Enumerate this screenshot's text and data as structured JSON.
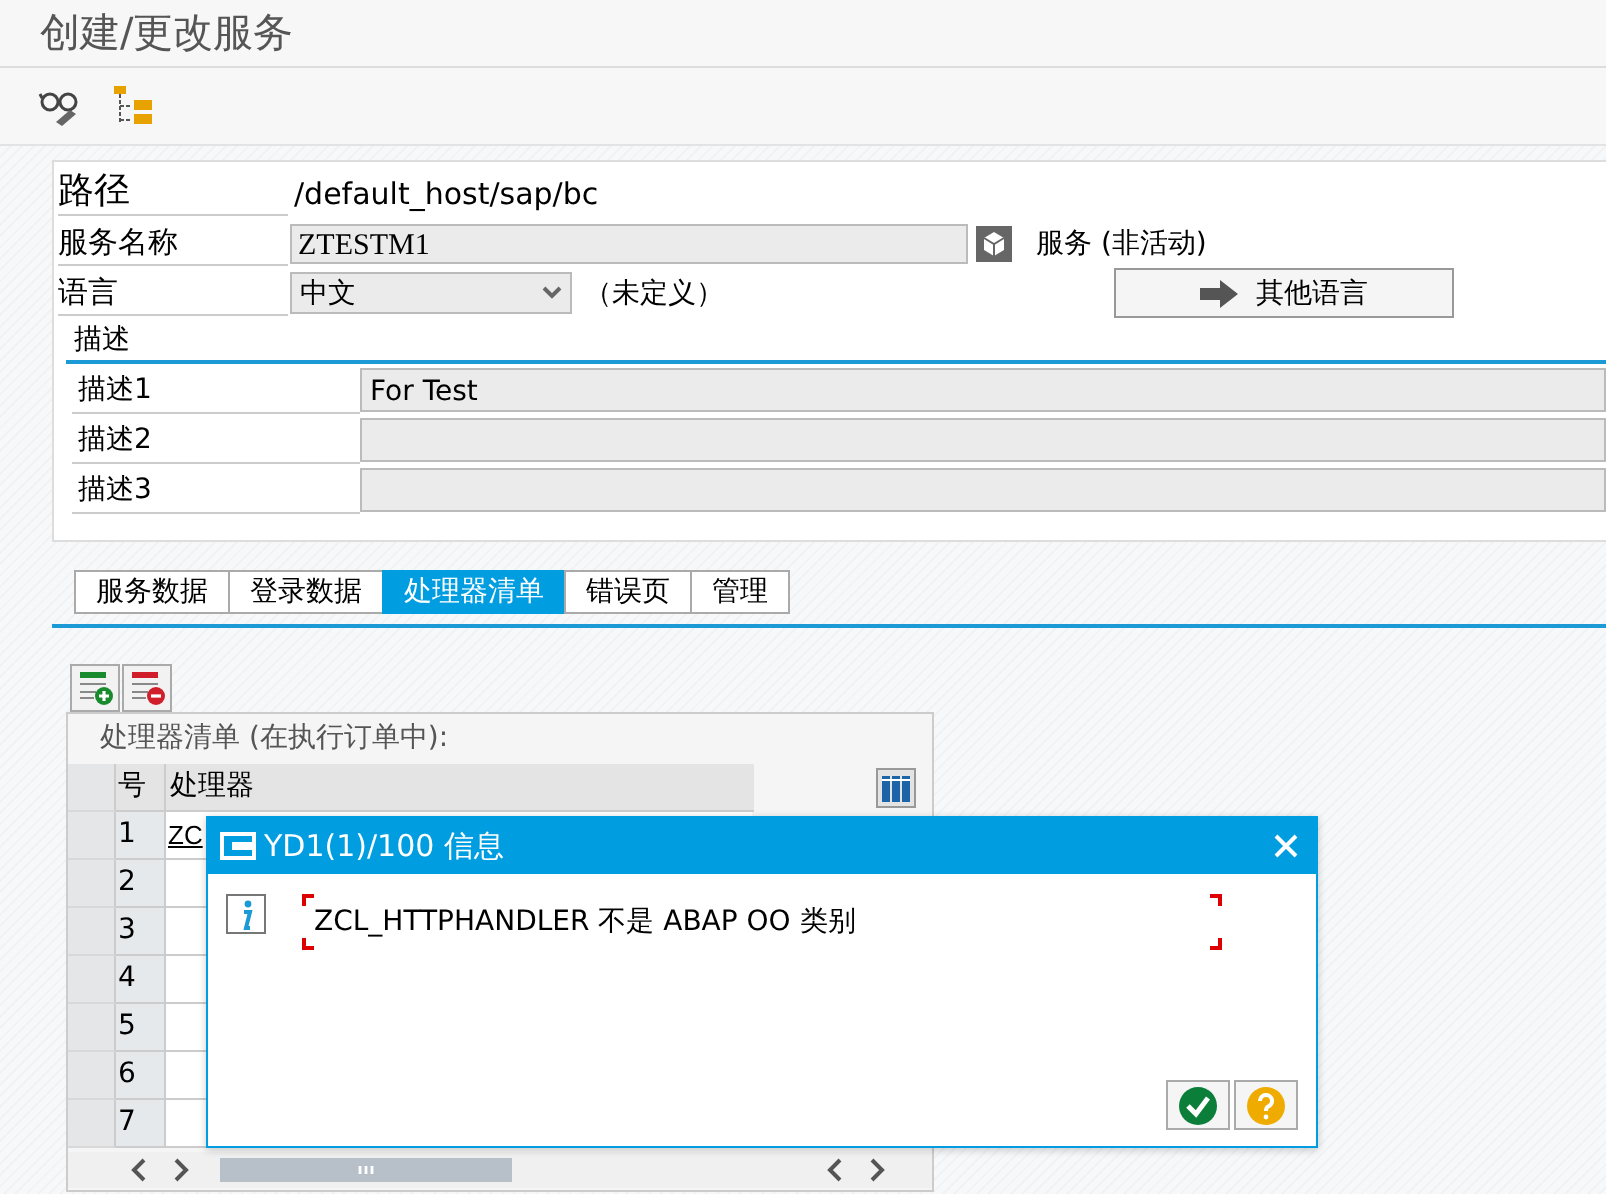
{
  "window": {
    "title": "创建/更改服务"
  },
  "form": {
    "path": {
      "label": "路径",
      "value": "/default_host/sap/bc"
    },
    "service_name": {
      "label": "服务名称",
      "value": "ZTESTM1",
      "status": "服务 (非活动)"
    },
    "language": {
      "label": "语言",
      "value": "中文",
      "note": "（未定义）",
      "button": "其他语言"
    }
  },
  "description": {
    "title": "描述",
    "rows": [
      {
        "label": "描述1",
        "value": "For Test"
      },
      {
        "label": "描述2"
      },
      {
        "label": "描述3"
      }
    ]
  },
  "tabs": [
    {
      "label": "服务数据",
      "selected": false
    },
    {
      "label": "登录数据",
      "selected": false
    },
    {
      "label": "处理器清单",
      "selected": true
    },
    {
      "label": "错误页",
      "selected": false
    },
    {
      "label": "管理",
      "selected": false
    }
  ],
  "handler_list": {
    "title": "处理器清单 (在执行订单中):",
    "columns": [
      "号",
      "处理器"
    ],
    "rows": [
      {
        "number": "1",
        "handler": "ZC"
      },
      {
        "number": "2"
      },
      {
        "number": "3"
      },
      {
        "number": "4"
      },
      {
        "number": "5"
      },
      {
        "number": "6"
      },
      {
        "number": "7"
      }
    ]
  },
  "dialog": {
    "title": "YD1(1)/100 信息",
    "message": "ZCL_HTTPHANDLER 不是 ABAP OO 类别"
  }
}
